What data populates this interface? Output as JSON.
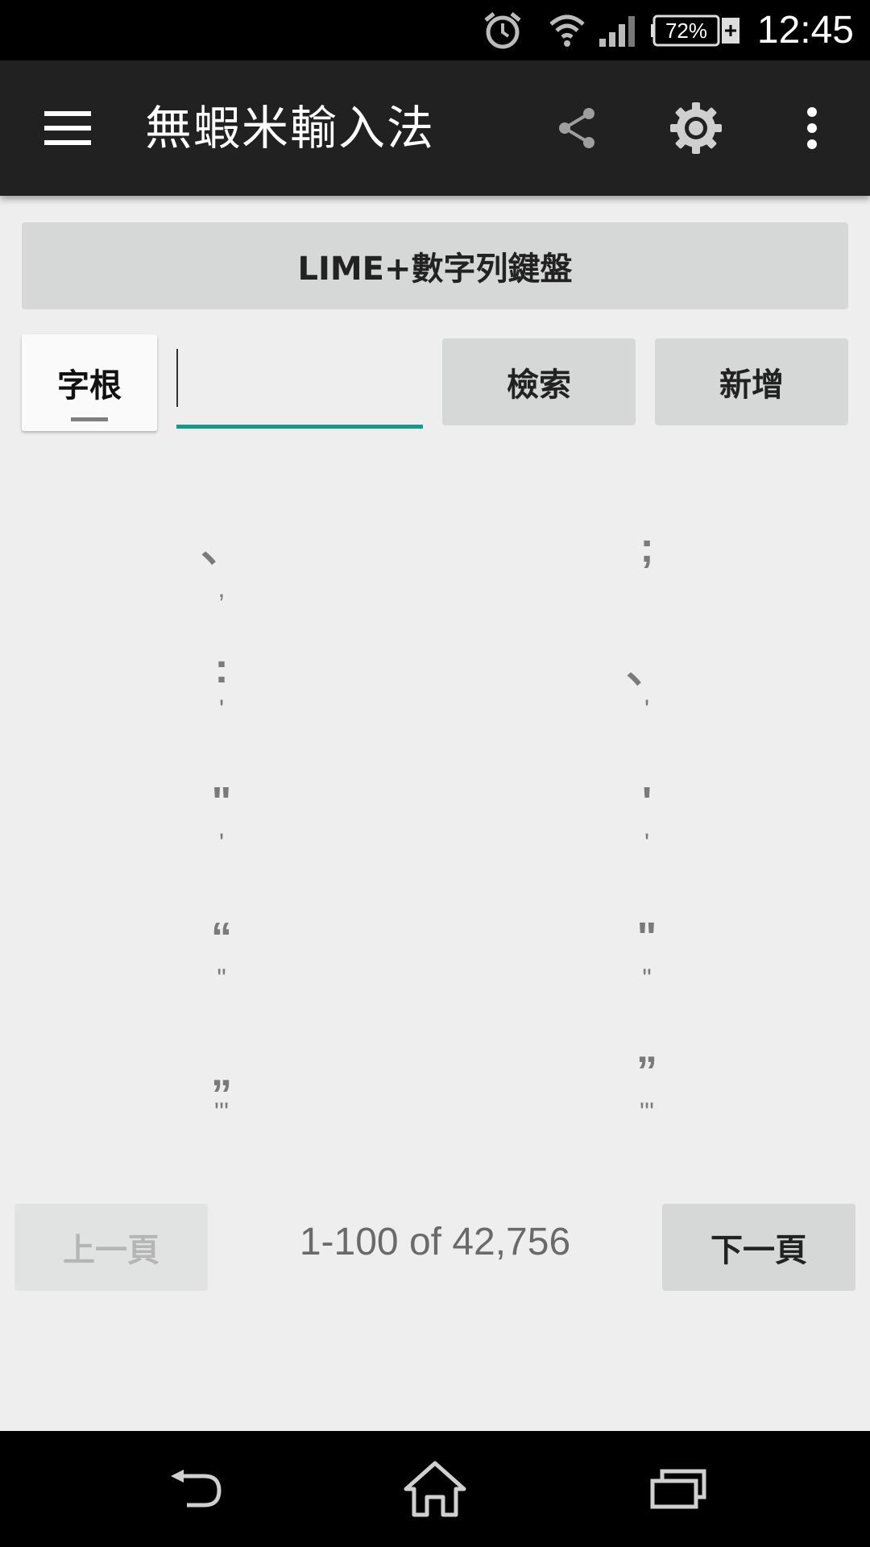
{
  "status_bar": {
    "time": "12:45",
    "battery_level": "72%",
    "icons": [
      "alarm-icon",
      "wifi-icon",
      "signal-icon",
      "battery-charging-icon"
    ]
  },
  "app_bar": {
    "title": "無蝦米輸入法",
    "icons": [
      "menu-icon",
      "share-icon",
      "settings-icon",
      "overflow-menu-icon"
    ]
  },
  "keyboard_button": {
    "label": "LIME+數字列鍵盤"
  },
  "search": {
    "field_label": "字根",
    "input_value": "",
    "search_label": "檢索",
    "add_label": "新增"
  },
  "results": [
    {
      "left": {
        "key": "、",
        "code": ","
      },
      "right": {
        "key": ";",
        "code": ""
      }
    },
    {
      "left": {
        "key": ":",
        "code": "'"
      },
      "right": {
        "key": "、",
        "code": "'"
      }
    },
    {
      "left": {
        "key": "\"",
        "code": "'"
      },
      "right": {
        "key": "'",
        "code": "'"
      }
    },
    {
      "left": {
        "key": "“",
        "code": "\""
      },
      "right": {
        "key": "\"",
        "code": "\""
      }
    },
    {
      "left": {
        "key": "„",
        "code": "'''"
      },
      "right": {
        "key": "”",
        "code": "'''"
      }
    }
  ],
  "pager": {
    "prev_label": "上一頁",
    "range_text": "1-100 of 42,756",
    "next_label": "下一頁"
  },
  "colors": {
    "app_bar": "#212121",
    "accent": "#159a8c",
    "button": "#d6d7d7",
    "background": "#eeeeee"
  }
}
